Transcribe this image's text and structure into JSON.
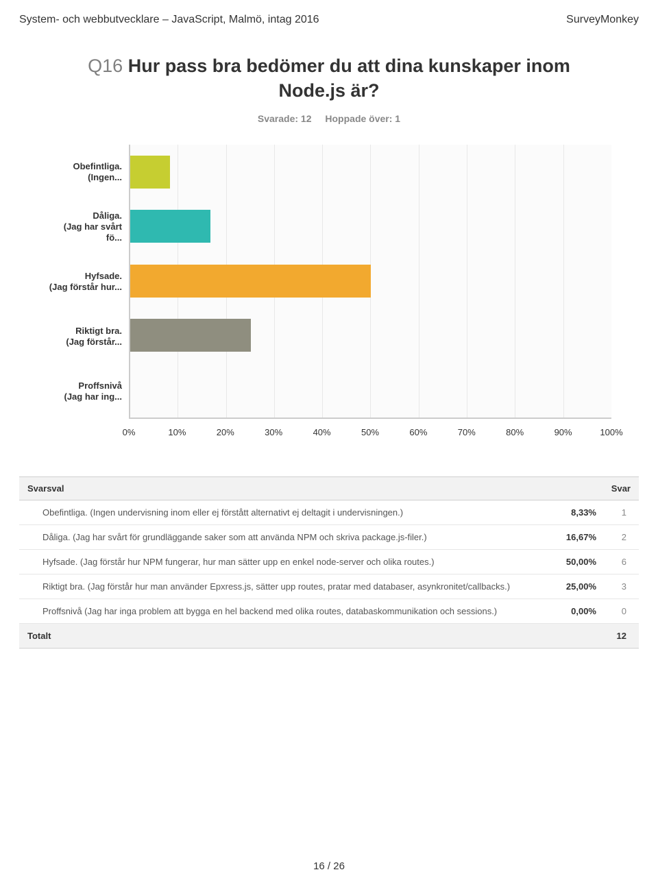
{
  "header": {
    "left": "System- och webbutvecklare – JavaScript, Malmö, intag 2016",
    "right": "SurveyMonkey"
  },
  "question": {
    "number": "Q16",
    "text": "Hur pass bra bedömer du att dina kunskaper inom Node.js är?"
  },
  "meta": {
    "answered_label": "Svarade: 12",
    "skipped_label": "Hoppade över: 1"
  },
  "chart_data": {
    "type": "bar",
    "orientation": "horizontal",
    "xlabel": "",
    "ylabel": "",
    "xlim": [
      0,
      100
    ],
    "x_ticks": [
      "0%",
      "10%",
      "20%",
      "30%",
      "40%",
      "50%",
      "60%",
      "70%",
      "80%",
      "90%",
      "100%"
    ],
    "categories": [
      "Obefintliga. (Ingen...",
      "Dåliga. (Jag har svårt fö...",
      "Hyfsade. (Jag förstår hur...",
      "Riktigt bra. (Jag förstår...",
      "Proffsnivå (Jag har ing..."
    ],
    "values": [
      8.33,
      16.67,
      50.0,
      25.0,
      0.0
    ],
    "colors": [
      "#c6ce31",
      "#2fb9b0",
      "#f2a92f",
      "#8f8e7f",
      "#cccccc"
    ]
  },
  "table": {
    "header_option": "Svarsval",
    "header_svar": "Svar",
    "rows": [
      {
        "label": "Obefintliga. (Ingen undervisning inom eller ej förstått alternativt ej deltagit i undervisningen.)",
        "pct": "8,33%",
        "count": "1"
      },
      {
        "label": "Dåliga. (Jag har svårt för grundläggande saker som att använda NPM och skriva package.js-filer.)",
        "pct": "16,67%",
        "count": "2"
      },
      {
        "label": "Hyfsade. (Jag förstår hur NPM fungerar, hur man sätter upp en enkel node-server och olika routes.)",
        "pct": "50,00%",
        "count": "6"
      },
      {
        "label": "Riktigt bra. (Jag förstår hur man använder Epxress.js, sätter upp routes, pratar med databaser, asynkronitet/callbacks.)",
        "pct": "25,00%",
        "count": "3"
      },
      {
        "label": "Proffsnivå (Jag har inga problem att bygga en hel backend med olika routes, databaskommunikation och sessions.)",
        "pct": "0,00%",
        "count": "0"
      }
    ],
    "total_label": "Totalt",
    "total_count": "12"
  },
  "footer": {
    "page": "16 / 26"
  }
}
